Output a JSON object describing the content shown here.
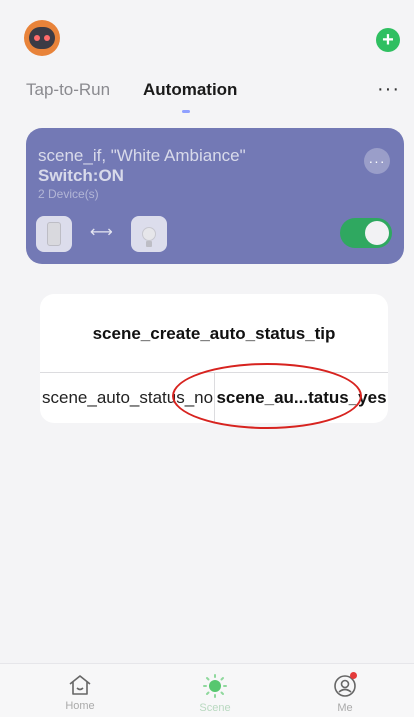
{
  "header": {
    "avatar_icon": "robot-avatar-icon",
    "add_icon_glyph": "+",
    "more_glyph": "···"
  },
  "tabs": [
    {
      "label": "Tap-to-Run",
      "active": false
    },
    {
      "label": "Automation",
      "active": true
    }
  ],
  "scene_card": {
    "title": "scene_if, \"White Ambiance\"",
    "subtitle": "Switch:ON",
    "device_count": "2 Device(s)",
    "more_glyph": "···",
    "arrow_glyph": "⟷",
    "enabled": true,
    "color": "#7379b5"
  },
  "dialog": {
    "title": "scene_create_auto_status_tip",
    "no_label": "scene_auto_status_no",
    "yes_label": "scene_au...tatus_yes"
  },
  "bottom_nav": {
    "items": [
      {
        "name": "home",
        "label": "Home"
      },
      {
        "name": "scene",
        "label": "Scene"
      },
      {
        "name": "me",
        "label": "Me"
      }
    ]
  },
  "colors": {
    "accent_green": "#2fbf61",
    "card": "#7379b5",
    "highlight": "#d7231f"
  }
}
